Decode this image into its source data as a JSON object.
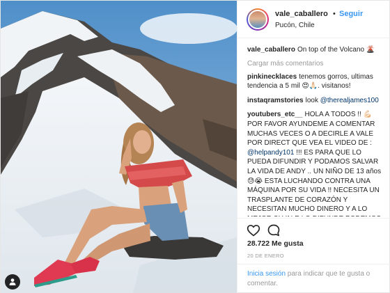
{
  "header": {
    "username": "vale_caballero",
    "separator": "•",
    "follow_label": "Seguir",
    "location": "Pucón, Chile"
  },
  "caption": {
    "username": "vale_caballero",
    "text": "On top of the Volcano 🌋"
  },
  "load_more_label": "Cargar más comentarios",
  "comments": [
    {
      "username": "pinkinecklaces",
      "text": "tenemos gorros, ultimas tendencia a 5 mil 😍🙏🏻. visitanos!"
    },
    {
      "username": "instaqramstories",
      "text": "look ",
      "mention": "@therealjames100"
    },
    {
      "username": "youtubers_etc__",
      "text": "HOLA A TODOS !! 💪🏻 POR FAVOR AYUNDEME A COMENTAR MUCHAS VECES O A DECIRLE A VALE POR DIRECT QUE VEA EL VIDEO DE :",
      "mention": "@helpandy101",
      "text2": " !!! ES PARA QUE LO PUEDA DIFUNDIR Y PODAMOS SALVAR LA VIDA DE ANDY .. UN NIÑO DE 13 años 😓😭 ESTA LUCHANDO CONTRA UNA MÁQUINA POR SU VIDA !! NECESITA UN TRASPLANTE DE CORAZÓN Y NECESITAN MUCHO DINERO Y A LO MEJOR SI VALE LO DIFUNDE PODEMOS CONSEGUIR QUE ANDY SIGA CON VIDA !! HAY QUE LOGRAR QUE VALE"
    }
  ],
  "likes": "28.722 Me gusta",
  "date": "20 DE ENERO",
  "login": {
    "link": "Inicia sesión",
    "text": " para indicar que te gusta o comentar."
  },
  "icons": {
    "like": "heart-icon",
    "comment": "comment-bubble-icon",
    "tag": "user-tag-icon"
  },
  "colors": {
    "link_blue": "#3897f0",
    "mention_blue": "#003569",
    "muted": "#999999"
  }
}
